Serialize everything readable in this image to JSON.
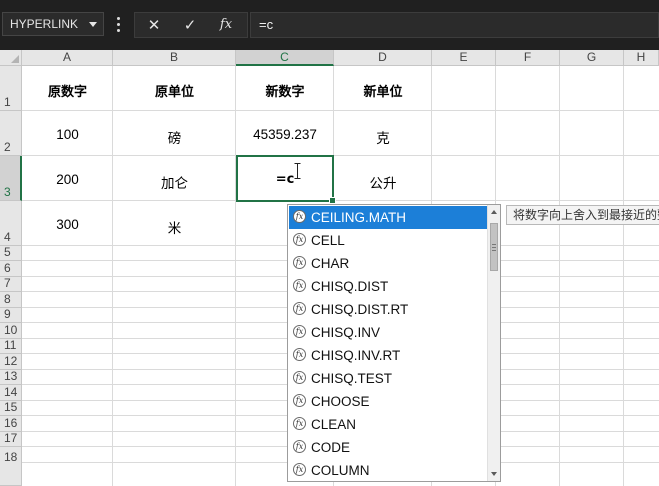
{
  "name_box": {
    "value": "HYPERLINK"
  },
  "formula_bar": {
    "cancel_icon": "✕",
    "enter_icon": "✓",
    "fx_label": "fx",
    "value": "=c"
  },
  "columns": [
    "A",
    "B",
    "C",
    "D",
    "E",
    "F",
    "G",
    "H"
  ],
  "rows": [
    "1",
    "2",
    "3",
    "4",
    "5",
    "6",
    "7",
    "8",
    "9",
    "10",
    "11",
    "12",
    "13",
    "14",
    "15",
    "16",
    "17",
    "18"
  ],
  "cells": {
    "A1": "原数字",
    "B1": "原单位",
    "C1": "新数字",
    "D1": "新单位",
    "A2": "100",
    "B2": "磅",
    "C2": "45359.237",
    "D2": "克",
    "A3": "200",
    "B3": "加仑",
    "C3": "=c",
    "D3": "公升",
    "A4": "300",
    "B4": "米"
  },
  "active_cell": "C3",
  "autocomplete": {
    "icon": "fx",
    "items": [
      "CEILING.MATH",
      "CELL",
      "CHAR",
      "CHISQ.DIST",
      "CHISQ.DIST.RT",
      "CHISQ.INV",
      "CHISQ.INV.RT",
      "CHISQ.TEST",
      "CHOOSE",
      "CLEAN",
      "CODE",
      "COLUMN"
    ],
    "selected_index": 0
  },
  "tooltip": "将数字向上舍入到最接近的整"
}
